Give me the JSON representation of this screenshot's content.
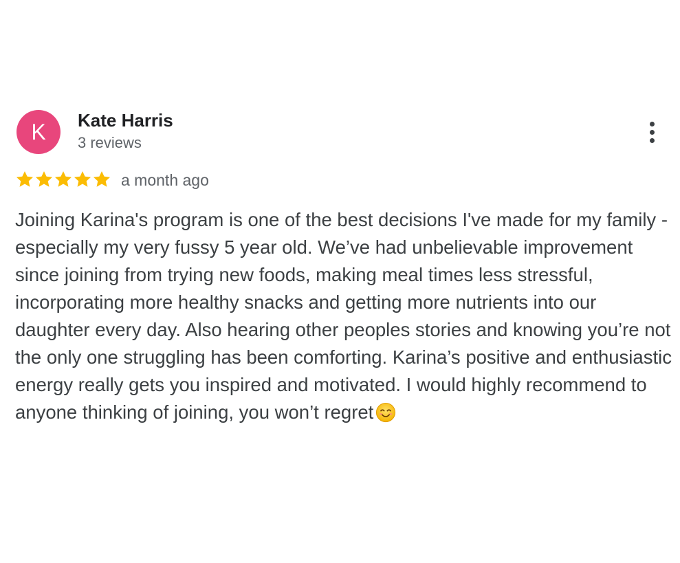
{
  "review": {
    "avatar_letter": "K",
    "avatar_color": "#e8467c",
    "reviewer_name": "Kate Harris",
    "review_count": "3 reviews",
    "rating": 5,
    "rating_max": 5,
    "star_color": "#fbbc04",
    "date": "a month ago",
    "text": "Joining Karina's program is one of the best decisions I've made for my family - especially my very fussy 5 year old. We’ve had unbelievable improvement since joining from trying new foods, making meal times less stressful, incorporating more healthy snacks and getting more nutrients into our daughter every day. Also hearing other peoples stories and knowing you’re not the only one struggling has been comforting. Karina’s positive and enthusiastic energy really gets you inspired and motivated. I would highly recommend to anyone thinking of joining, you won’t regret",
    "trailing_emoji": "smiling-face-with-smiling-eyes-icon",
    "menu_icon": "more-vertical-icon"
  }
}
